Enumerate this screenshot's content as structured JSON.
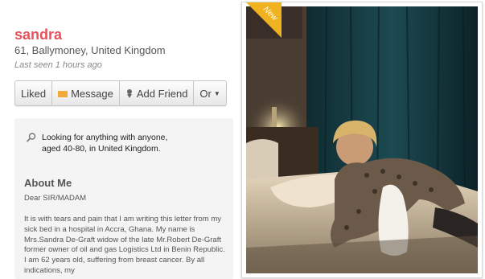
{
  "profile": {
    "name": "sandra",
    "details": "61, Ballymoney, United Kingdom",
    "last_seen": "Last seen 1 hours ago"
  },
  "actions": {
    "liked": "Liked",
    "message": "Message",
    "add_friend": "Add Friend",
    "or": "Or"
  },
  "looking_for": {
    "line1": "Looking for anything with anyone,",
    "line2": "aged 40-80, in United Kingdom."
  },
  "about": {
    "heading": "About Me",
    "salutation": "Dear SIR/MADAM",
    "body": "It is with tears and pain that I am writing this letter from my sick bed in a hospital in Accra, Ghana. My name is Mrs.Sandra De-Graft widow of the late Mr.Robert De-Graft former owner of oil and gas Logistics Ltd in Benin Republic. I am 62 years old, suffering from breast cancer. By all indications, my"
  },
  "photo": {
    "badge": "New"
  },
  "colors": {
    "name": "#e8505b",
    "badge": "#f0b21e",
    "message_icon": "#f3a93a"
  }
}
